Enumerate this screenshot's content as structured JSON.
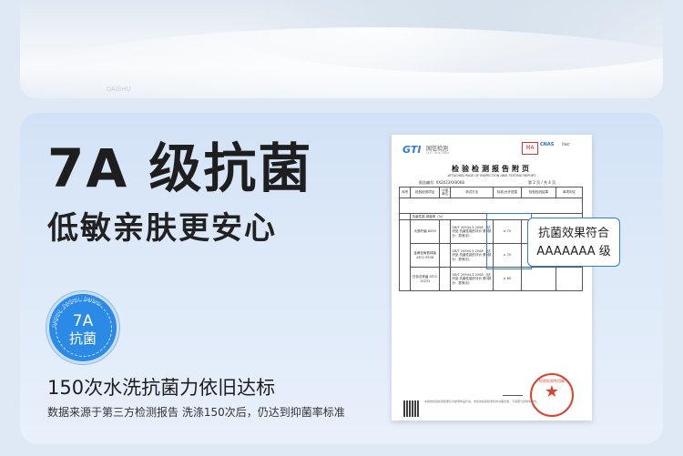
{
  "top_banner": {
    "watermark": "DAISHU"
  },
  "headline": "7A 级抗菌",
  "subheadline": "低敏亲肤更安心",
  "badge": {
    "ring_text": "DAISHU · DAISHU · DAISHU",
    "grade": "7A",
    "label": "抗菌"
  },
  "caption": {
    "main": "150次水洗抗菌力依旧达标",
    "note": "数据来源于第三方检测报告 洗涤150次后，仍达到抑菌率标准"
  },
  "report": {
    "logo": "GTI",
    "logo_cn": "国信检测",
    "logo_en": "GTI TESTING",
    "ma": "MA",
    "cnas": "CNAS",
    "ilac": "ilac",
    "title": "检验检测报告附页",
    "title_en": "ATTACHED PAGE OF INSPECTION AND TESTING REPORT",
    "report_no": "报告编号: XX2023XX0068",
    "page": "第 2 页 / 共 4 页",
    "headers": [
      "序号",
      "检验检测项目",
      "计量单位",
      "测试方法",
      "标准/允许范围",
      "检验检测结果",
      "单项判定"
    ],
    "section": "抗菌性能-抑菌率（%）",
    "rows": [
      {
        "item": "大肠杆菌 8099",
        "method": "GB/T 20944.3-2008 《纺织品 抗菌性能的评价 第3部分：振荡法》",
        "std": "≥ 70"
      },
      {
        "item": "金黄色葡萄球菌 ATCC 6538",
        "method": "GB/T 20944.3-2008 《纺织品 抗菌性能的评价 第3部分：振荡法》",
        "std": "≥ 70"
      },
      {
        "item": "白色念珠菌 ATCC 10231",
        "method": "GB/T 20944.3-2008 《纺织品 抗菌性能的评价 第3部分：振荡法》",
        "std": "≥ 60"
      }
    ],
    "footer": "本报告检验检测结果仅对被测样品负责。未经本检验检测机构书面批准，不得部分复制本报告。",
    "seal": "检验检测专用章"
  },
  "callout": {
    "line1": "抗菌效果符合",
    "line2": "AAAAAAA 级"
  }
}
